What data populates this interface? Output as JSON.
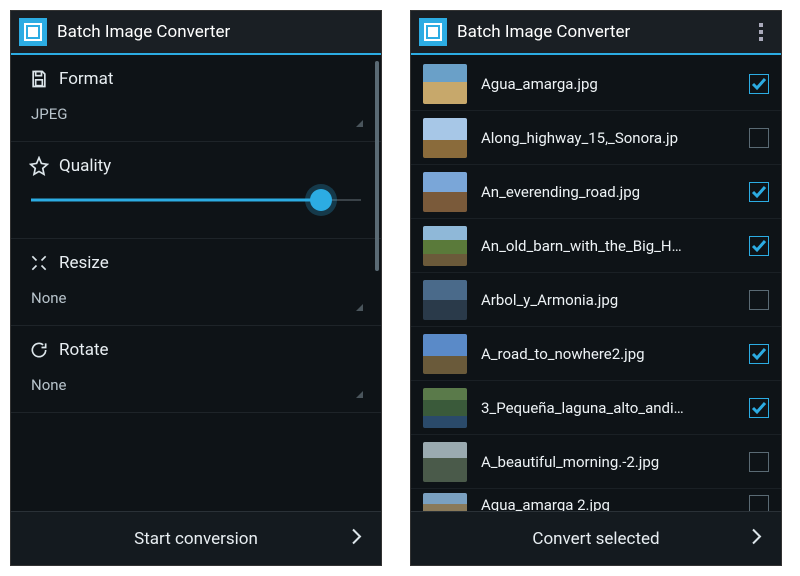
{
  "left": {
    "title": "Batch Image Converter",
    "format": {
      "label": "Format",
      "value": "JPEG"
    },
    "quality": {
      "label": "Quality",
      "percent": 88
    },
    "resize": {
      "label": "Resize",
      "value": "None"
    },
    "rotate": {
      "label": "Rotate",
      "value": "None"
    },
    "action": "Start conversion"
  },
  "right": {
    "title": "Batch Image Converter",
    "files": [
      {
        "name": "Agua_amarga.jpg",
        "checked": true
      },
      {
        "name": "Along_highway_15,_Sonora.jp",
        "checked": false
      },
      {
        "name": "An_everending_road.jpg",
        "checked": true
      },
      {
        "name": "An_old_barn_with_the_Big_H…",
        "checked": true
      },
      {
        "name": "Arbol_y_Armonia.jpg",
        "checked": false
      },
      {
        "name": "A_road_to_nowhere2.jpg",
        "checked": true
      },
      {
        "name": "3_Pequeña_laguna_alto_andi…",
        "checked": true
      },
      {
        "name": "A_beautiful_morning.-2.jpg",
        "checked": false
      },
      {
        "name": "Agua_amarga 2.jpg",
        "checked": false
      }
    ],
    "action": "Convert selected"
  }
}
